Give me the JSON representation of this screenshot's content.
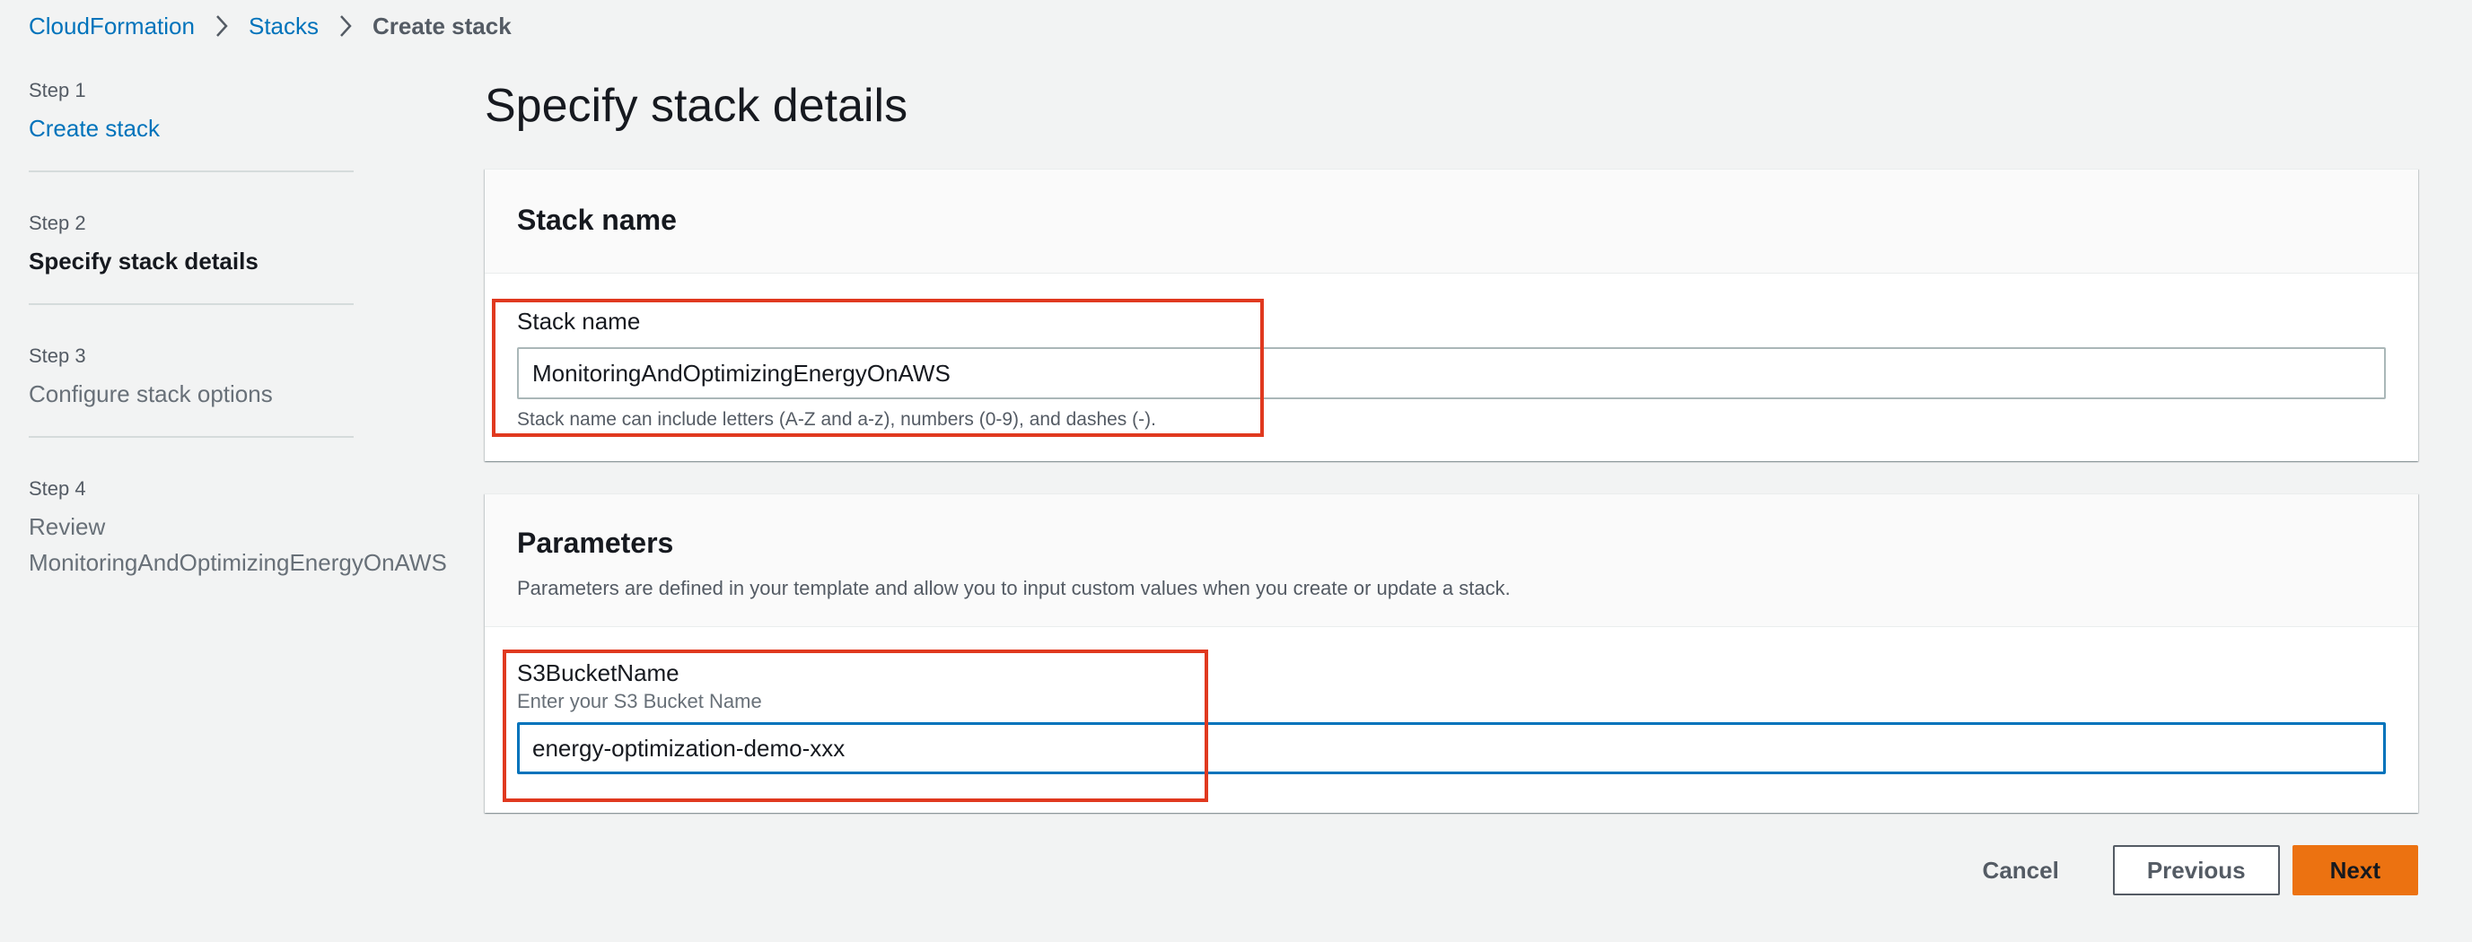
{
  "breadcrumb": {
    "items": [
      "CloudFormation",
      "Stacks"
    ],
    "current": "Create stack"
  },
  "wizard": {
    "steps": [
      {
        "num": "Step 1",
        "title": "Create stack"
      },
      {
        "num": "Step 2",
        "title": "Specify stack details"
      },
      {
        "num": "Step 3",
        "title": "Configure stack options"
      },
      {
        "num": "Step 4",
        "title": "Review",
        "subtitle": "MonitoringAndOptimizingEnergyOnAWS"
      }
    ]
  },
  "page": {
    "title": "Specify stack details"
  },
  "stack_name_panel": {
    "header": "Stack name",
    "label": "Stack name",
    "value": "MonitoringAndOptimizingEnergyOnAWS",
    "constraint": "Stack name can include letters (A-Z and a-z), numbers (0-9), and dashes (-)."
  },
  "parameters_panel": {
    "header": "Parameters",
    "description": "Parameters are defined in your template and allow you to input custom values when you create or update a stack.",
    "field": {
      "label": "S3BucketName",
      "description": "Enter your S3 Bucket Name",
      "value": "energy-optimization-demo-xxx"
    }
  },
  "actions": {
    "cancel": "Cancel",
    "previous": "Previous",
    "next": "Next"
  },
  "colors": {
    "link": "#0073bb",
    "primary_button": "#ec7211",
    "highlight": "#e0391f",
    "focus": "#0073bb"
  }
}
